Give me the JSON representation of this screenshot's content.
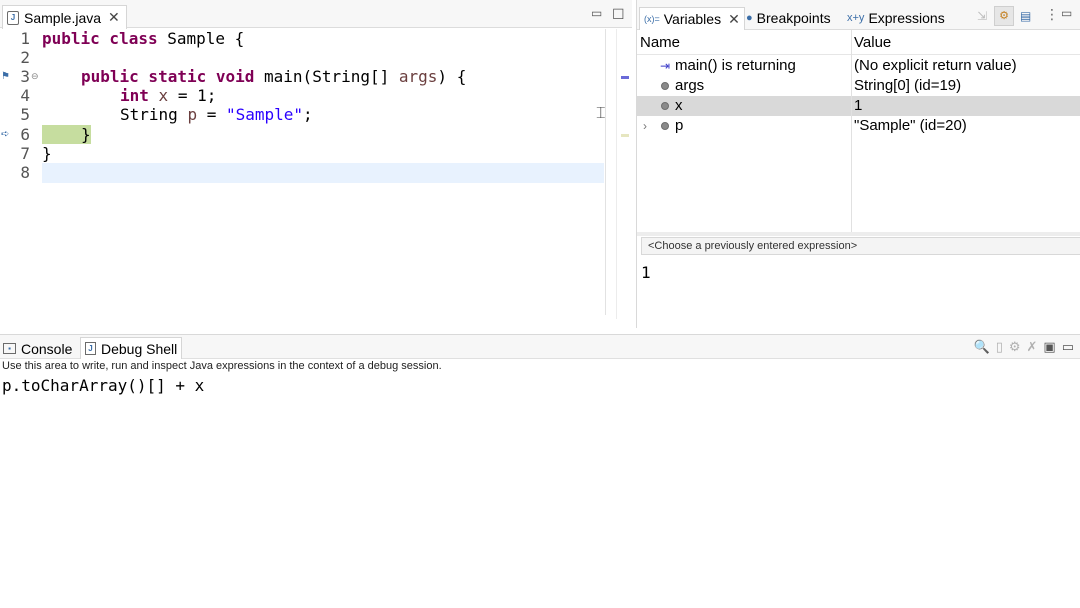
{
  "editor": {
    "tab_label": "Sample.java",
    "tab_close": "✕",
    "line_numbers": [
      "1",
      "2",
      "3",
      "4",
      "5",
      "6",
      "7",
      "8"
    ],
    "code": {
      "l1_kw": "public class",
      "l1_rest": " Sample {",
      "l3_kw1": "public static void",
      "l3_mid": " main(String[] ",
      "l3_var": "args",
      "l3_end": ") {",
      "l4_kw": "int",
      "l4_mid": " ",
      "l4_var": "x",
      "l4_end": " = 1;",
      "l5_pre": "String ",
      "l5_var": "p",
      "l5_mid": " = ",
      "l5_str": "\"Sample\"",
      "l5_end": ";",
      "l6": "}",
      "l7": "}"
    }
  },
  "variables_view": {
    "tabs": [
      {
        "label": "Variables",
        "icon": "variables-icon",
        "close": "✕"
      },
      {
        "label": "Breakpoints",
        "icon": "breakpoints-icon"
      },
      {
        "label": "Expressions",
        "icon": "expressions-icon"
      }
    ],
    "columns": {
      "name": "Name",
      "value": "Value"
    },
    "rows": [
      {
        "name": "main() is returning",
        "value": "(No explicit return value)"
      },
      {
        "name": "args",
        "value": "String[0]  (id=19)"
      },
      {
        "name": "x",
        "value": "1"
      },
      {
        "name": "p",
        "value": "\"Sample\" (id=20)"
      }
    ],
    "expression_placeholder": "<Choose a previously entered expression>",
    "result": "1",
    "selected_row_color": "#d9d9d9"
  },
  "bottom": {
    "tabs": [
      {
        "label": "Console",
        "icon": "console-icon"
      },
      {
        "label": "Debug Shell",
        "icon": "debug-shell-icon"
      }
    ],
    "hint": "Use this area to write, run and inspect Java expressions in the context of a debug session.",
    "shell_text": "p.toCharArray()[] + x"
  },
  "colors": {
    "keyword": "#7f0055",
    "string": "#2a00ff",
    "local_var": "#6a3e3e",
    "current_line": "#e8f2fe",
    "debug_highlight": "#c6dd9f"
  }
}
